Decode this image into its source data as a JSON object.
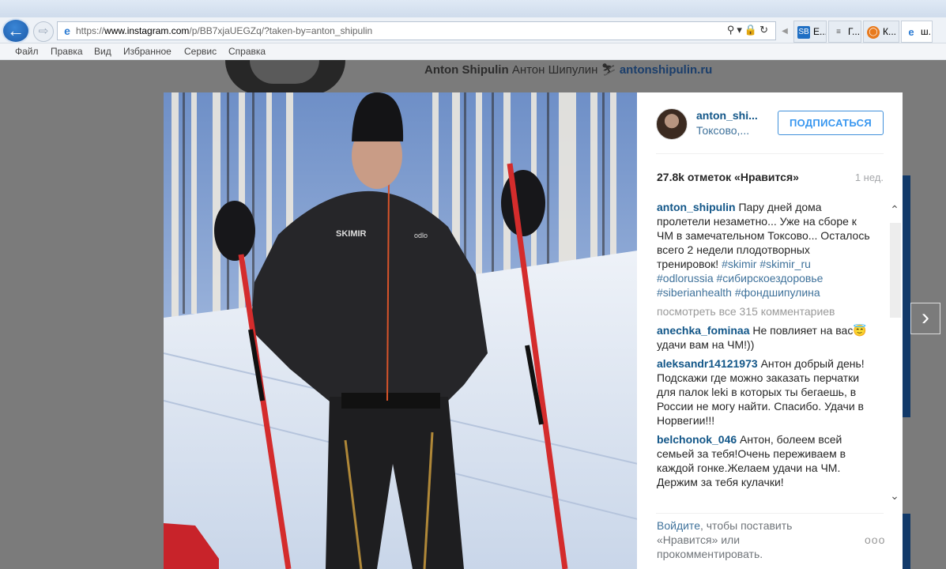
{
  "browser": {
    "url_prefix": "https://",
    "url_host": "www.instagram.com",
    "url_path": "/p/BB7xjaUEGZq/?taken-by=anton_shipulin",
    "tabs": [
      {
        "icon": "sb-favicon",
        "label": "E..."
      },
      {
        "icon": "bar-favicon",
        "label": "Г..."
      },
      {
        "icon": "ie-orange-favicon",
        "label": "К..."
      },
      {
        "icon": "ie-favicon",
        "label": "ш..."
      }
    ],
    "menu": [
      "Файл",
      "Правка",
      "Вид",
      "Избранное",
      "Сервис",
      "Справка"
    ]
  },
  "background_profile": {
    "name": "Anton Shipulin",
    "name_ru": "Антон Шипулин",
    "website": "antonshipulin.ru"
  },
  "post": {
    "username": "anton_shi...",
    "location": "Токсово,...",
    "follow_label": "ПОДПИСАТЬСЯ",
    "likes": "27.8k отметок «Нравится»",
    "time": "1 нед.",
    "caption": {
      "user": "anton_shipulin",
      "text": "Пару дней дома пролетели незаметно... Уже на сборе к ЧМ в замечательном Токсово... Осталось всего 2 недели плодотворных тренировок!",
      "tags": [
        "#skimir",
        "#skimir_ru",
        "#odlorussia",
        "#сибирскоездоровье",
        "#siberianhealth",
        "#фондшипулина"
      ]
    },
    "load_more": "посмотреть все 315 комментариев",
    "comments": [
      {
        "user": "anechka_fominaa",
        "text": "Не повлияет на вас😇 удачи вам на ЧМ!))"
      },
      {
        "user": "aleksandr14121973",
        "text": "Антон добрый день! Подскажи где можно заказать перчатки для палок leki в которых ты бегаешь, в России не могу найти. Спасибо. Удачи в Норвегии!!!"
      },
      {
        "user": "belchonok_046",
        "text": "Антон, болеем всей семьей за тебя!Очень переживаем в каждой гонке.Желаем удачи на ЧМ. Держим за тебя кулачки!"
      }
    ],
    "login_link": "Войдите",
    "login_text": ", чтобы поставить «Нравится» или прокомментировать.",
    "more": "ooo"
  },
  "photo": {
    "jacket_brand": "SKIMIR",
    "jacket_logo": "odlo"
  }
}
